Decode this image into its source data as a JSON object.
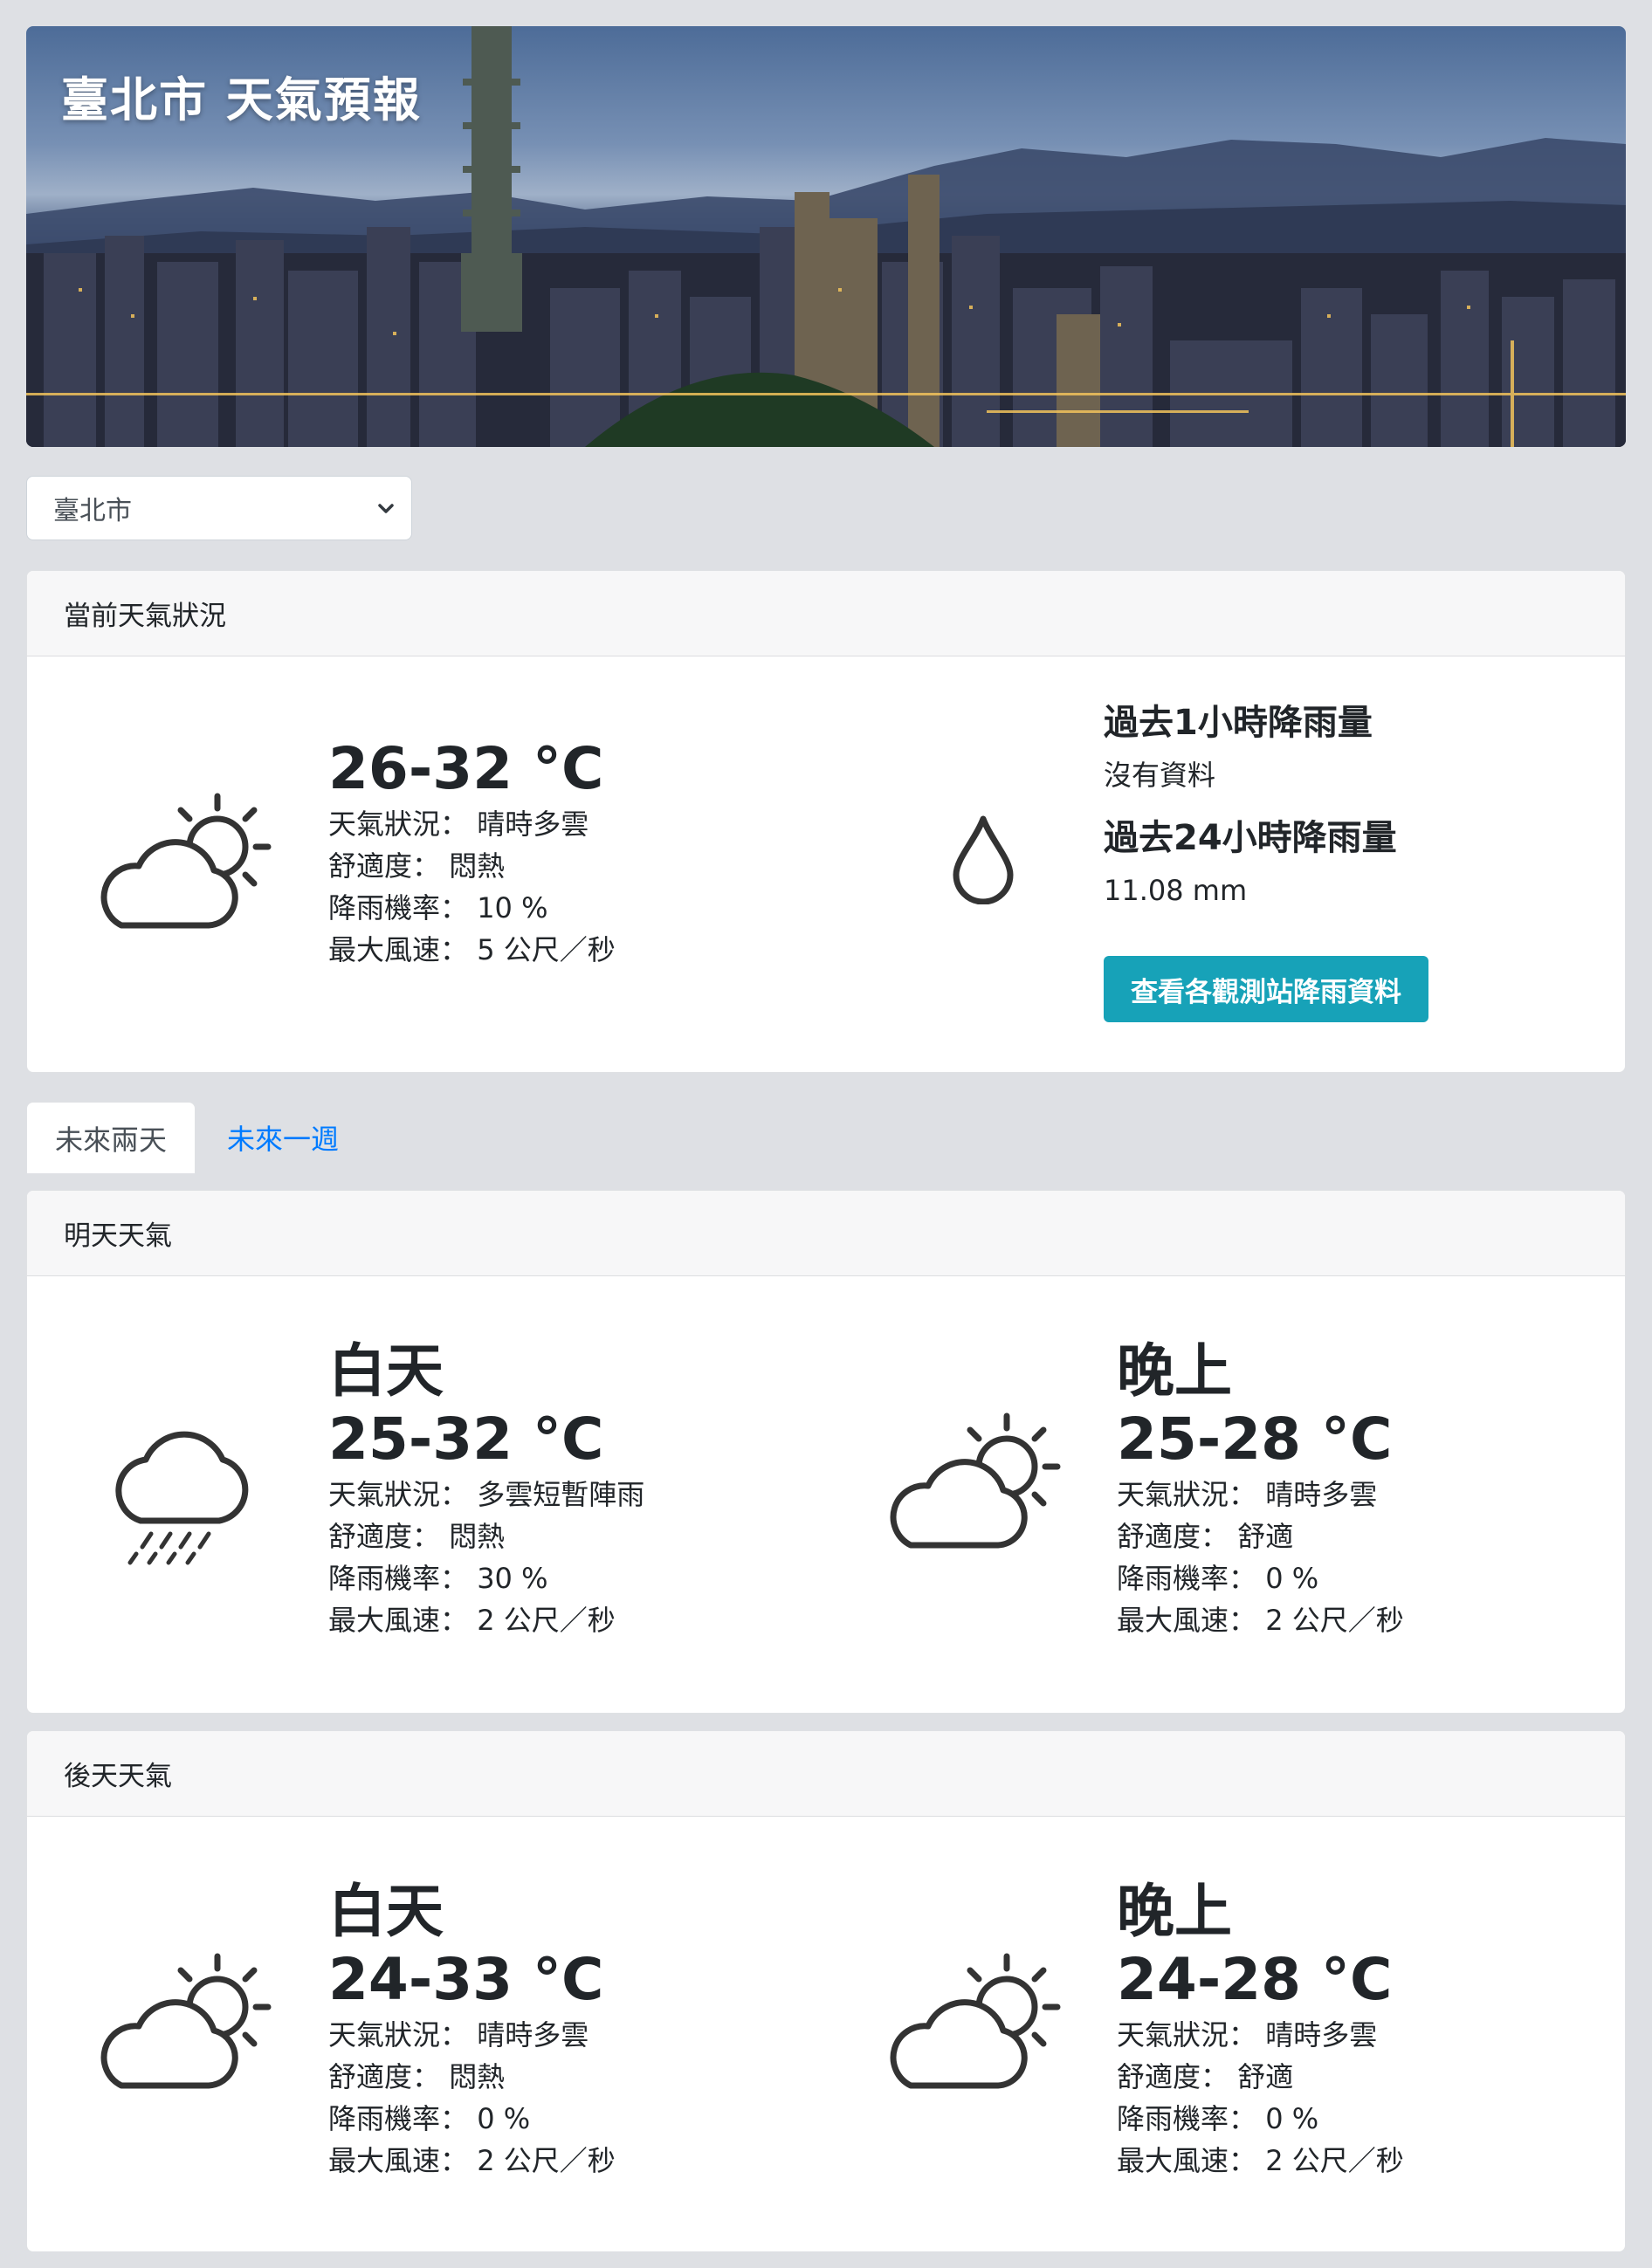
{
  "banner": {
    "title": "臺北市 天氣預報"
  },
  "city_select": {
    "value": "臺北市"
  },
  "current": {
    "header": "當前天氣狀況",
    "icon": "partly-cloudy-day-icon",
    "temp": "26-32 °C",
    "rows": [
      {
        "label": "天氣狀況：",
        "value": "晴時多雲"
      },
      {
        "label": "舒適度：",
        "value": "悶熱"
      },
      {
        "label": "降雨機率：",
        "value": "10 %"
      },
      {
        "label": "最大風速：",
        "value": "5 公尺／秒"
      }
    ],
    "rain_icon": "raindrop-icon",
    "rain_1h_title": "過去1小時降雨量",
    "rain_1h_value": "沒有資料",
    "rain_24h_title": "過去24小時降雨量",
    "rain_24h_value": "11.08 mm",
    "stations_button": "查看各觀測站降雨資料"
  },
  "tabs": {
    "two_days": "未來兩天",
    "one_week": "未來一週"
  },
  "tomorrow": {
    "header": "明天天氣",
    "day": {
      "title": "白天",
      "icon": "rain-icon",
      "temp": "25-32 °C",
      "rows": [
        {
          "label": "天氣狀況：",
          "value": "多雲短暫陣雨"
        },
        {
          "label": "舒適度：",
          "value": "悶熱"
        },
        {
          "label": "降雨機率：",
          "value": "30 %"
        },
        {
          "label": "最大風速：",
          "value": "2 公尺／秒"
        }
      ]
    },
    "night": {
      "title": "晚上",
      "icon": "partly-cloudy-day-icon",
      "temp": "25-28 °C",
      "rows": [
        {
          "label": "天氣狀況：",
          "value": "晴時多雲"
        },
        {
          "label": "舒適度：",
          "value": "舒適"
        },
        {
          "label": "降雨機率：",
          "value": "0 %"
        },
        {
          "label": "最大風速：",
          "value": "2 公尺／秒"
        }
      ]
    }
  },
  "after_tomorrow": {
    "header": "後天天氣",
    "day": {
      "title": "白天",
      "icon": "partly-cloudy-day-icon",
      "temp": "24-33 °C",
      "rows": [
        {
          "label": "天氣狀況：",
          "value": "晴時多雲"
        },
        {
          "label": "舒適度：",
          "value": "悶熱"
        },
        {
          "label": "降雨機率：",
          "value": "0 %"
        },
        {
          "label": "最大風速：",
          "value": "2 公尺／秒"
        }
      ]
    },
    "night": {
      "title": "晚上",
      "icon": "partly-cloudy-day-icon",
      "temp": "24-28 °C",
      "rows": [
        {
          "label": "天氣狀況：",
          "value": "晴時多雲"
        },
        {
          "label": "舒適度：",
          "value": "舒適"
        },
        {
          "label": "降雨機率：",
          "value": "0 %"
        },
        {
          "label": "最大風速：",
          "value": "2 公尺／秒"
        }
      ]
    }
  },
  "colors": {
    "accent_button": "#17a2b8",
    "link": "#007bff",
    "page_bg": "#dee0e4"
  }
}
